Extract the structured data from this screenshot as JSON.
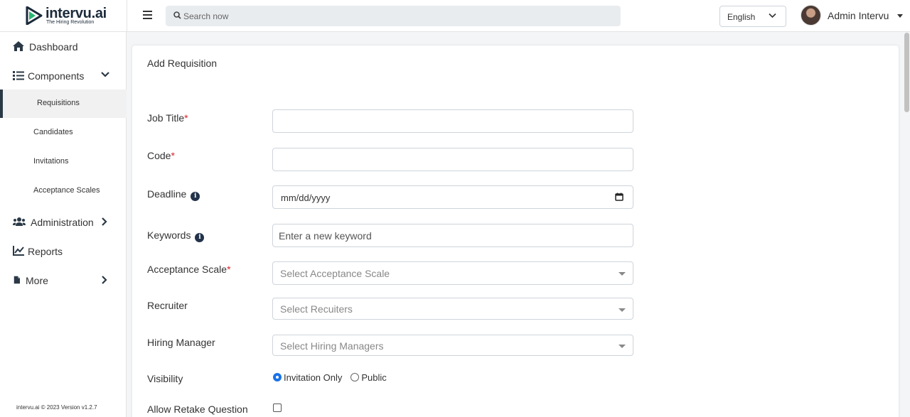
{
  "brand": {
    "name_main": "intervu",
    "name_suffix": ".ai",
    "tagline": "The Hiring Revolution",
    "accent": "#2bb673"
  },
  "header": {
    "search_placeholder": "Search now",
    "language": "English",
    "user_name": "Admin Intervu"
  },
  "sidebar": {
    "dashboard": "Dashboard",
    "components": "Components",
    "sub_items": [
      "Requisitions",
      "Candidates",
      "Invitations",
      "Acceptance Scales"
    ],
    "administration": "Administration",
    "reports": "Reports",
    "more": "More",
    "footer": "intervu.ai © 2023 Version v1.2.7"
  },
  "form": {
    "title": "Add Requisition",
    "job_title_label": "Job Title",
    "code_label": "Code",
    "deadline_label": "Deadline",
    "deadline_value": "mm/dd/yyyy",
    "keywords_label": "Keywords",
    "keywords_placeholder": "Enter a new keyword",
    "acceptance_scale_label": "Acceptance Scale",
    "acceptance_scale_placeholder": "Select Acceptance Scale",
    "recruiter_label": "Recruiter",
    "recruiter_placeholder": "Select Recuiters",
    "hiring_manager_label": "Hiring Manager",
    "hiring_manager_placeholder": "Select Hiring Managers",
    "visibility_label": "Visibility",
    "visibility_options": [
      "Invitation Only",
      "Public"
    ],
    "visibility_selected": "Invitation Only",
    "retake_label": "Allow Retake Question",
    "required_mark": "*",
    "info_glyph": "i"
  }
}
